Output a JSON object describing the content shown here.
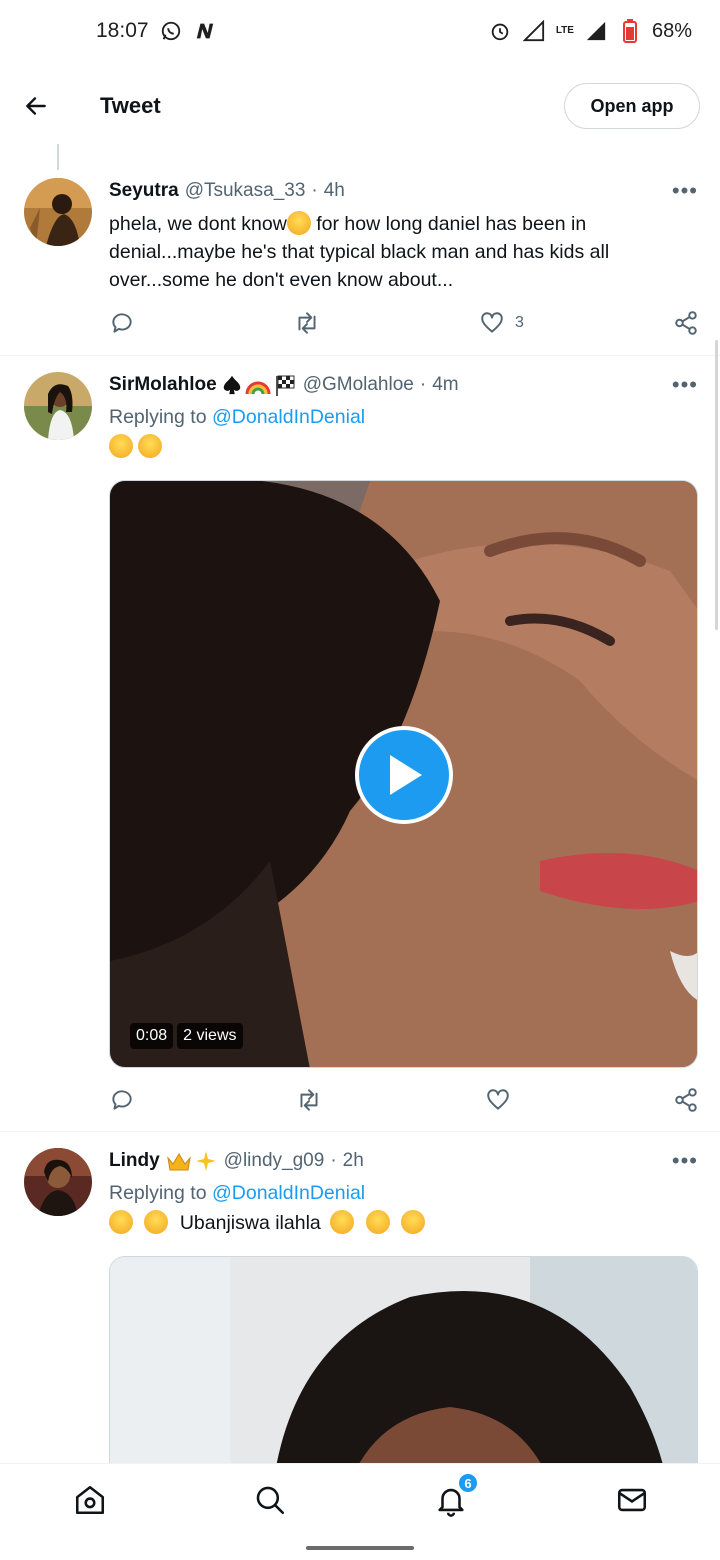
{
  "status_bar": {
    "time": "18:07",
    "network": "LTE",
    "battery": "68%"
  },
  "header": {
    "title": "Tweet",
    "open_app_label": "Open app"
  },
  "tweets": [
    {
      "name": "Seyutra",
      "handle": "@Tsukasa_33",
      "time": "4h",
      "text_part1": "phela, we dont know",
      "text_part2": " for how long daniel has been in denial...maybe he's that typical black man and has kids all over...some he don't even know about...",
      "likes": "3"
    },
    {
      "name": "SirMolahloe",
      "handle": "@GMolahloe",
      "time": "4m",
      "replying_prefix": "Replying to",
      "replying_to": "@DonaldInDenial",
      "video": {
        "duration": "0:08",
        "views": "2 views"
      }
    },
    {
      "name": "Lindy",
      "handle": "@lindy_g09",
      "time": "2h",
      "replying_prefix": "Replying to",
      "replying_to": "@DonaldInDenial",
      "text": "Ubanjiswa ilahla"
    }
  ],
  "bottom_nav": {
    "notification_count": "6"
  },
  "colors": {
    "accent": "#1d9bf0",
    "secondary_text": "#536471"
  }
}
